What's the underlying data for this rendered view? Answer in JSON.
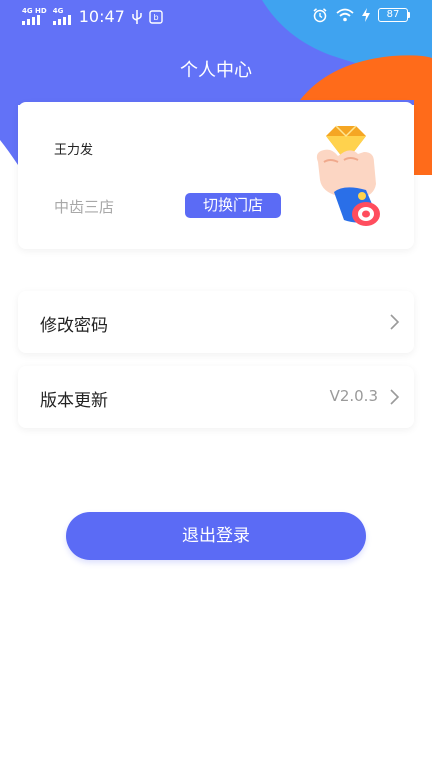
{
  "status_bar": {
    "network_1": "4G HD",
    "network_2": "4G",
    "time": "10:47",
    "battery": "87"
  },
  "header": {
    "title": "个人中心"
  },
  "profile": {
    "user_name": "王力发",
    "store_name": "中齿三店",
    "switch_store_label": "切换门店"
  },
  "menu": {
    "change_password": {
      "label": "修改密码"
    },
    "version_update": {
      "label": "版本更新",
      "value": "V2.0.3"
    }
  },
  "logout_label": "退出登录",
  "colors": {
    "primary": "#5b6bf5",
    "header_blue": "#6272f7",
    "accent_orange": "#ff6b1a",
    "accent_blue": "#3fa3f0"
  }
}
